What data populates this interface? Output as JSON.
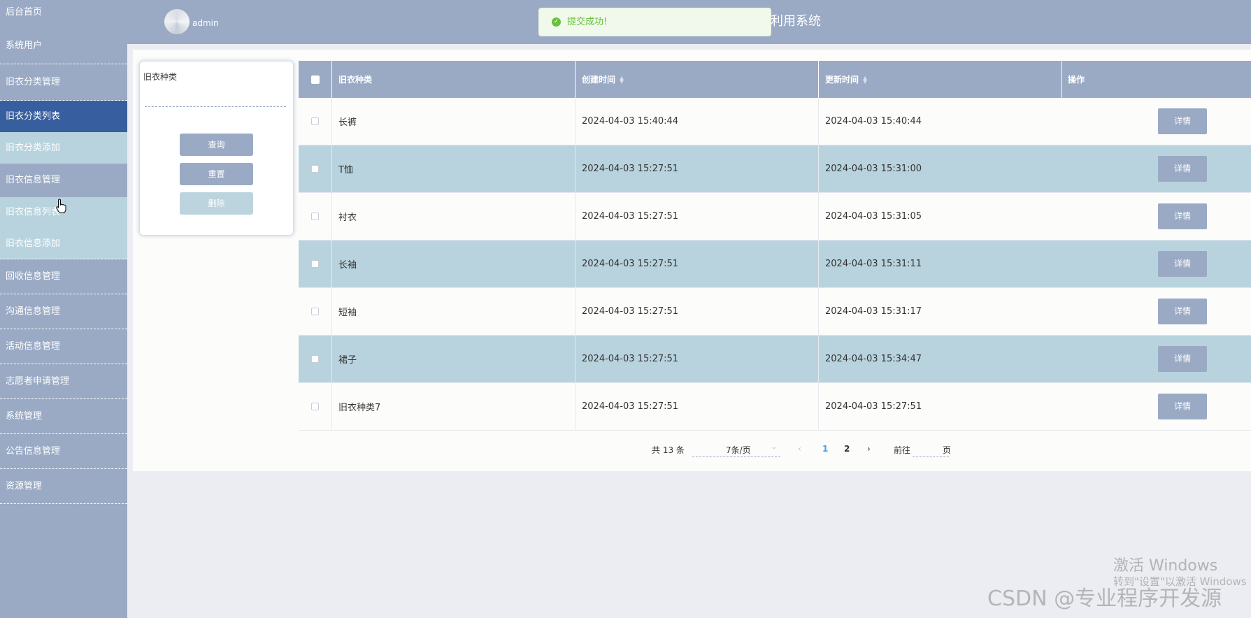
{
  "sidebar": {
    "items": [
      {
        "label": "后台首页"
      },
      {
        "label": "系统用户"
      },
      {
        "label": "旧衣分类管理"
      },
      {
        "label": "旧衣分类列表"
      },
      {
        "label": "旧衣分类添加"
      },
      {
        "label": "旧衣信息管理"
      },
      {
        "label": "旧衣信息列表"
      },
      {
        "label": "旧衣信息添加"
      },
      {
        "label": "回收信息管理"
      },
      {
        "label": "沟通信息管理"
      },
      {
        "label": "活动信息管理"
      },
      {
        "label": "志愿者申请管理"
      },
      {
        "label": "系统管理"
      },
      {
        "label": "公告信息管理"
      },
      {
        "label": "资源管理"
      }
    ],
    "active": "旧衣分类列表"
  },
  "header": {
    "username": "admin",
    "title_visible": "利用系统"
  },
  "toast": {
    "message": "提交成功!",
    "icon": "check-circle-icon",
    "color": "#67c23a"
  },
  "search": {
    "label": "旧衣种类",
    "value": "",
    "query_button": "查询",
    "reset_button": "重置",
    "delete_button": "删除"
  },
  "table": {
    "headers": {
      "name": "旧衣种类",
      "created": "创建时间",
      "updated": "更新时间",
      "action": "操作"
    },
    "rows": [
      {
        "name": "长裤",
        "created": "2024-04-03 15:40:44",
        "updated": "2024-04-03 15:40:44",
        "action": "详情"
      },
      {
        "name": "T恤",
        "created": "2024-04-03 15:27:51",
        "updated": "2024-04-03 15:31:00",
        "action": "详情"
      },
      {
        "name": "衬衣",
        "created": "2024-04-03 15:27:51",
        "updated": "2024-04-03 15:31:05",
        "action": "详情"
      },
      {
        "name": "长袖",
        "created": "2024-04-03 15:27:51",
        "updated": "2024-04-03 15:31:11",
        "action": "详情"
      },
      {
        "name": "短袖",
        "created": "2024-04-03 15:27:51",
        "updated": "2024-04-03 15:31:17",
        "action": "详情"
      },
      {
        "name": "裙子",
        "created": "2024-04-03 15:27:51",
        "updated": "2024-04-03 15:34:47",
        "action": "详情"
      },
      {
        "name": "旧衣种类7",
        "created": "2024-04-03 15:27:51",
        "updated": "2024-04-03 15:27:51",
        "action": "详情"
      }
    ]
  },
  "pagination": {
    "total": "共 13 条",
    "page_size": "7条/页",
    "pages": [
      "1",
      "2"
    ],
    "current": "1",
    "goto_prefix": "前往",
    "goto_suffix": "页",
    "goto_value": ""
  },
  "watermark": {
    "activate_title": "激活 Windows",
    "activate_sub": "转到\"设置\"以激活 Windows",
    "csdn": "CSDN @专业程序开发源"
  },
  "colors": {
    "primary": "#9aaac4",
    "active_menu": "#375e9e",
    "submenu": "#b8d3de",
    "success": "#67c23a"
  }
}
